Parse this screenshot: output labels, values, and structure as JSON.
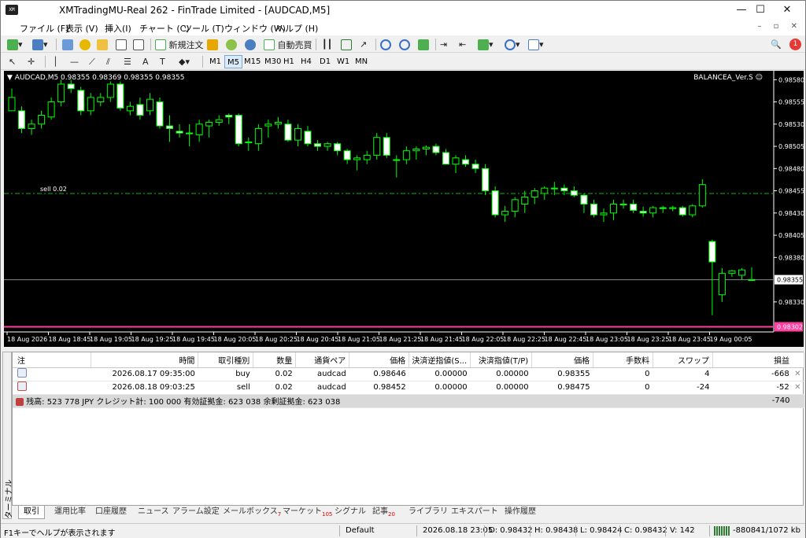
{
  "window": {
    "title": "XMTradingMU-Real 262 - FinTrade Limited - [AUDCAD,M5]",
    "min": "—",
    "max": "☐",
    "close": "✕"
  },
  "menu": [
    "ファイル (F)",
    "表示 (V)",
    "挿入(I)",
    "チャート (C)",
    "ツール (T)",
    "ウィンドウ (W)",
    "ヘルプ (H)"
  ],
  "toolbar": {
    "new_order": "新規注文",
    "auto_trade": "自動売買",
    "notification_count": "1"
  },
  "timeframes": [
    "M1",
    "M5",
    "M15",
    "M30",
    "H1",
    "H4",
    "D1",
    "W1",
    "MN"
  ],
  "timeframe_active": "M5",
  "chart": {
    "header": "▼ AUDCAD,M5  0.98355 0.98369 0.98355 0.98355",
    "indicator": "BALANCEA_Ver.S ☺",
    "order_line_label": "sell 0.02",
    "current_price_label": "0.98355",
    "bottom_price_label": "0.98302",
    "colors": {
      "bull": "#00ff00",
      "bear": "#ffffff",
      "order_line": "#00c000",
      "bottom_line": "#ff40a0"
    }
  },
  "chart_data": {
    "type": "candlestick",
    "symbol": "AUDCAD",
    "timeframe": "M5",
    "y_ticks": [
      "0.98580",
      "0.98555",
      "0.98530",
      "0.98505",
      "0.98480",
      "0.98455",
      "0.98430",
      "0.98405",
      "0.98380",
      "0.98330"
    ],
    "ylim": [
      0.98298,
      0.9859
    ],
    "x_ticks": [
      "18 Aug 2026",
      "18 Aug 18:45",
      "18 Aug 19:05",
      "18 Aug 19:25",
      "18 Aug 19:45",
      "18 Aug 20:05",
      "18 Aug 20:25",
      "18 Aug 20:45",
      "18 Aug 21:05",
      "18 Aug 21:25",
      "18 Aug 21:45",
      "18 Aug 22:05",
      "18 Aug 22:25",
      "18 Aug 22:45",
      "18 Aug 23:05",
      "18 Aug 23:25",
      "18 Aug 23:45",
      "19 Aug 00:05"
    ],
    "order_line": 0.98452,
    "current_price": 0.98355,
    "bottom_line": 0.98302,
    "candles": [
      [
        0.98545,
        0.9857,
        0.98545,
        0.9856
      ],
      [
        0.98545,
        0.9855,
        0.9852,
        0.98525
      ],
      [
        0.98525,
        0.98535,
        0.98518,
        0.9853
      ],
      [
        0.9853,
        0.98545,
        0.98525,
        0.9854
      ],
      [
        0.98538,
        0.9856,
        0.98535,
        0.98555
      ],
      [
        0.98555,
        0.9858,
        0.9855,
        0.98575
      ],
      [
        0.98575,
        0.9858,
        0.98565,
        0.9857
      ],
      [
        0.98568,
        0.98572,
        0.9854,
        0.98545
      ],
      [
        0.98545,
        0.98565,
        0.9854,
        0.9856
      ],
      [
        0.98555,
        0.98565,
        0.9855,
        0.9856
      ],
      [
        0.9856,
        0.98578,
        0.98555,
        0.98575
      ],
      [
        0.98575,
        0.98578,
        0.98545,
        0.98548
      ],
      [
        0.98545,
        0.98555,
        0.9854,
        0.9855
      ],
      [
        0.98552,
        0.9856,
        0.98535,
        0.9854
      ],
      [
        0.98545,
        0.98565,
        0.9854,
        0.98558
      ],
      [
        0.98555,
        0.9856,
        0.98525,
        0.98528
      ],
      [
        0.98528,
        0.9854,
        0.9851,
        0.98525
      ],
      [
        0.98522,
        0.9853,
        0.98515,
        0.9852
      ],
      [
        0.9852,
        0.9853,
        0.98505,
        0.9852
      ],
      [
        0.98518,
        0.98535,
        0.9851,
        0.9853
      ],
      [
        0.98528,
        0.98535,
        0.98515,
        0.98532
      ],
      [
        0.98532,
        0.9854,
        0.98528,
        0.98535
      ],
      [
        0.9854,
        0.98542,
        0.9853,
        0.98538
      ],
      [
        0.9854,
        0.98542,
        0.98505,
        0.98508
      ],
      [
        0.9851,
        0.98515,
        0.985,
        0.9851
      ],
      [
        0.98508,
        0.9853,
        0.985,
        0.98525
      ],
      [
        0.98528,
        0.98535,
        0.98515,
        0.9853
      ],
      [
        0.9853,
        0.98538,
        0.98525,
        0.98532
      ],
      [
        0.9853,
        0.98535,
        0.9851,
        0.98512
      ],
      [
        0.98512,
        0.9853,
        0.98505,
        0.98525
      ],
      [
        0.98522,
        0.98528,
        0.98505,
        0.98508
      ],
      [
        0.98508,
        0.98512,
        0.985,
        0.98505
      ],
      [
        0.98505,
        0.9851,
        0.985,
        0.98508
      ],
      [
        0.98508,
        0.9851,
        0.98495,
        0.985
      ],
      [
        0.985,
        0.98502,
        0.98485,
        0.9849
      ],
      [
        0.9849,
        0.98495,
        0.98478,
        0.98492
      ],
      [
        0.9849,
        0.985,
        0.98485,
        0.98495
      ],
      [
        0.98495,
        0.9852,
        0.9849,
        0.98515
      ],
      [
        0.98515,
        0.9852,
        0.98492,
        0.98495
      ],
      [
        0.9849,
        0.98495,
        0.9847,
        0.9849
      ],
      [
        0.9849,
        0.98505,
        0.98485,
        0.985
      ],
      [
        0.985,
        0.98505,
        0.9849,
        0.98502
      ],
      [
        0.98502,
        0.98506,
        0.98495,
        0.98504
      ],
      [
        0.98505,
        0.98508,
        0.98495,
        0.98498
      ],
      [
        0.98498,
        0.98502,
        0.98485,
        0.98485
      ],
      [
        0.98485,
        0.98495,
        0.98475,
        0.98492
      ],
      [
        0.9849,
        0.98495,
        0.98482,
        0.98485
      ],
      [
        0.98485,
        0.9849,
        0.98475,
        0.9848
      ],
      [
        0.9848,
        0.98485,
        0.9845,
        0.98455
      ],
      [
        0.98455,
        0.9846,
        0.98425,
        0.98428
      ],
      [
        0.98428,
        0.98438,
        0.9842,
        0.98432
      ],
      [
        0.98432,
        0.98448,
        0.98425,
        0.98445
      ],
      [
        0.9844,
        0.98455,
        0.9843,
        0.98448
      ],
      [
        0.98448,
        0.98458,
        0.9844,
        0.98455
      ],
      [
        0.98452,
        0.9846,
        0.98445,
        0.98458
      ],
      [
        0.98458,
        0.98465,
        0.9845,
        0.98458
      ],
      [
        0.98458,
        0.98462,
        0.9845,
        0.98455
      ],
      [
        0.98455,
        0.9846,
        0.98448,
        0.9845
      ],
      [
        0.9845,
        0.98452,
        0.9843,
        0.9844
      ],
      [
        0.9844,
        0.98445,
        0.98425,
        0.98428
      ],
      [
        0.98428,
        0.98435,
        0.9842,
        0.9843
      ],
      [
        0.9843,
        0.98445,
        0.98422,
        0.9844
      ],
      [
        0.9844,
        0.98445,
        0.98435,
        0.9844
      ],
      [
        0.9844,
        0.98445,
        0.9843,
        0.98433
      ],
      [
        0.98432,
        0.98437,
        0.98426,
        0.9843
      ],
      [
        0.9843,
        0.98438,
        0.98425,
        0.98436
      ],
      [
        0.98436,
        0.98438,
        0.9843,
        0.98435
      ],
      [
        0.98435,
        0.98438,
        0.98432,
        0.98436
      ],
      [
        0.98436,
        0.98438,
        0.98426,
        0.98428
      ],
      [
        0.98428,
        0.9844,
        0.98425,
        0.98438
      ],
      [
        0.98438,
        0.98468,
        0.98436,
        0.98462
      ],
      [
        0.98398,
        0.984,
        0.98315,
        0.98375
      ],
      [
        0.98338,
        0.98368,
        0.9833,
        0.98362
      ],
      [
        0.98362,
        0.98366,
        0.98358,
        0.98365
      ],
      [
        0.9836,
        0.98368,
        0.98355,
        0.98366
      ],
      [
        0.98355,
        0.98369,
        0.98355,
        0.98355
      ]
    ]
  },
  "terminal": {
    "side_label": "ターミナル",
    "columns": [
      "注",
      "時間",
      "取引種別",
      "数量",
      "通貨ペア",
      "価格",
      "決済逆指値(S...",
      "決済指値(T/P)",
      "価格",
      "手数料",
      "スワップ",
      "損益"
    ],
    "rows": [
      {
        "time": "2026.08.17 09:35:00",
        "type": "buy",
        "volume": "0.02",
        "symbol": "audcad",
        "price": "0.98646",
        "sl": "0.00000",
        "tp": "0.00000",
        "cur_price": "0.98355",
        "commission": "0",
        "swap": "4",
        "profit": "-668"
      },
      {
        "time": "2026.08.18 09:03:25",
        "type": "sell",
        "volume": "0.02",
        "symbol": "audcad",
        "price": "0.98452",
        "sl": "0.00000",
        "tp": "0.00000",
        "cur_price": "0.98475",
        "commission": "0",
        "swap": "-24",
        "profit": "-52"
      }
    ],
    "balance_text": "残高: 523 778 JPY  クレジット計: 100 000  有効証拠金: 623 038  余剰証拠金: 623 038",
    "balance_profit": "-740",
    "tabs": [
      {
        "label": "取引",
        "badge": ""
      },
      {
        "label": "運用比率",
        "badge": ""
      },
      {
        "label": "口座履歴",
        "badge": ""
      },
      {
        "label": "ニュース",
        "badge": ""
      },
      {
        "label": "アラーム設定",
        "badge": ""
      },
      {
        "label": "メールボックス",
        "badge": "7"
      },
      {
        "label": "マーケット",
        "badge": "105"
      },
      {
        "label": "シグナル",
        "badge": ""
      },
      {
        "label": "記事",
        "badge": "20"
      },
      {
        "label": "ライブラリ",
        "badge": ""
      },
      {
        "label": "エキスパート",
        "badge": ""
      },
      {
        "label": "操作履歴",
        "badge": ""
      }
    ]
  },
  "status": {
    "help": "F1キーでヘルプが表示されます",
    "profile": "Default",
    "datetime": "2026.08.18 23:05",
    "open": "O: 0.98432",
    "high": "H: 0.98438",
    "low": "L: 0.98424",
    "close": "C: 0.98432",
    "volume": "V: 142",
    "traffic": "-880841/1072 kb"
  }
}
